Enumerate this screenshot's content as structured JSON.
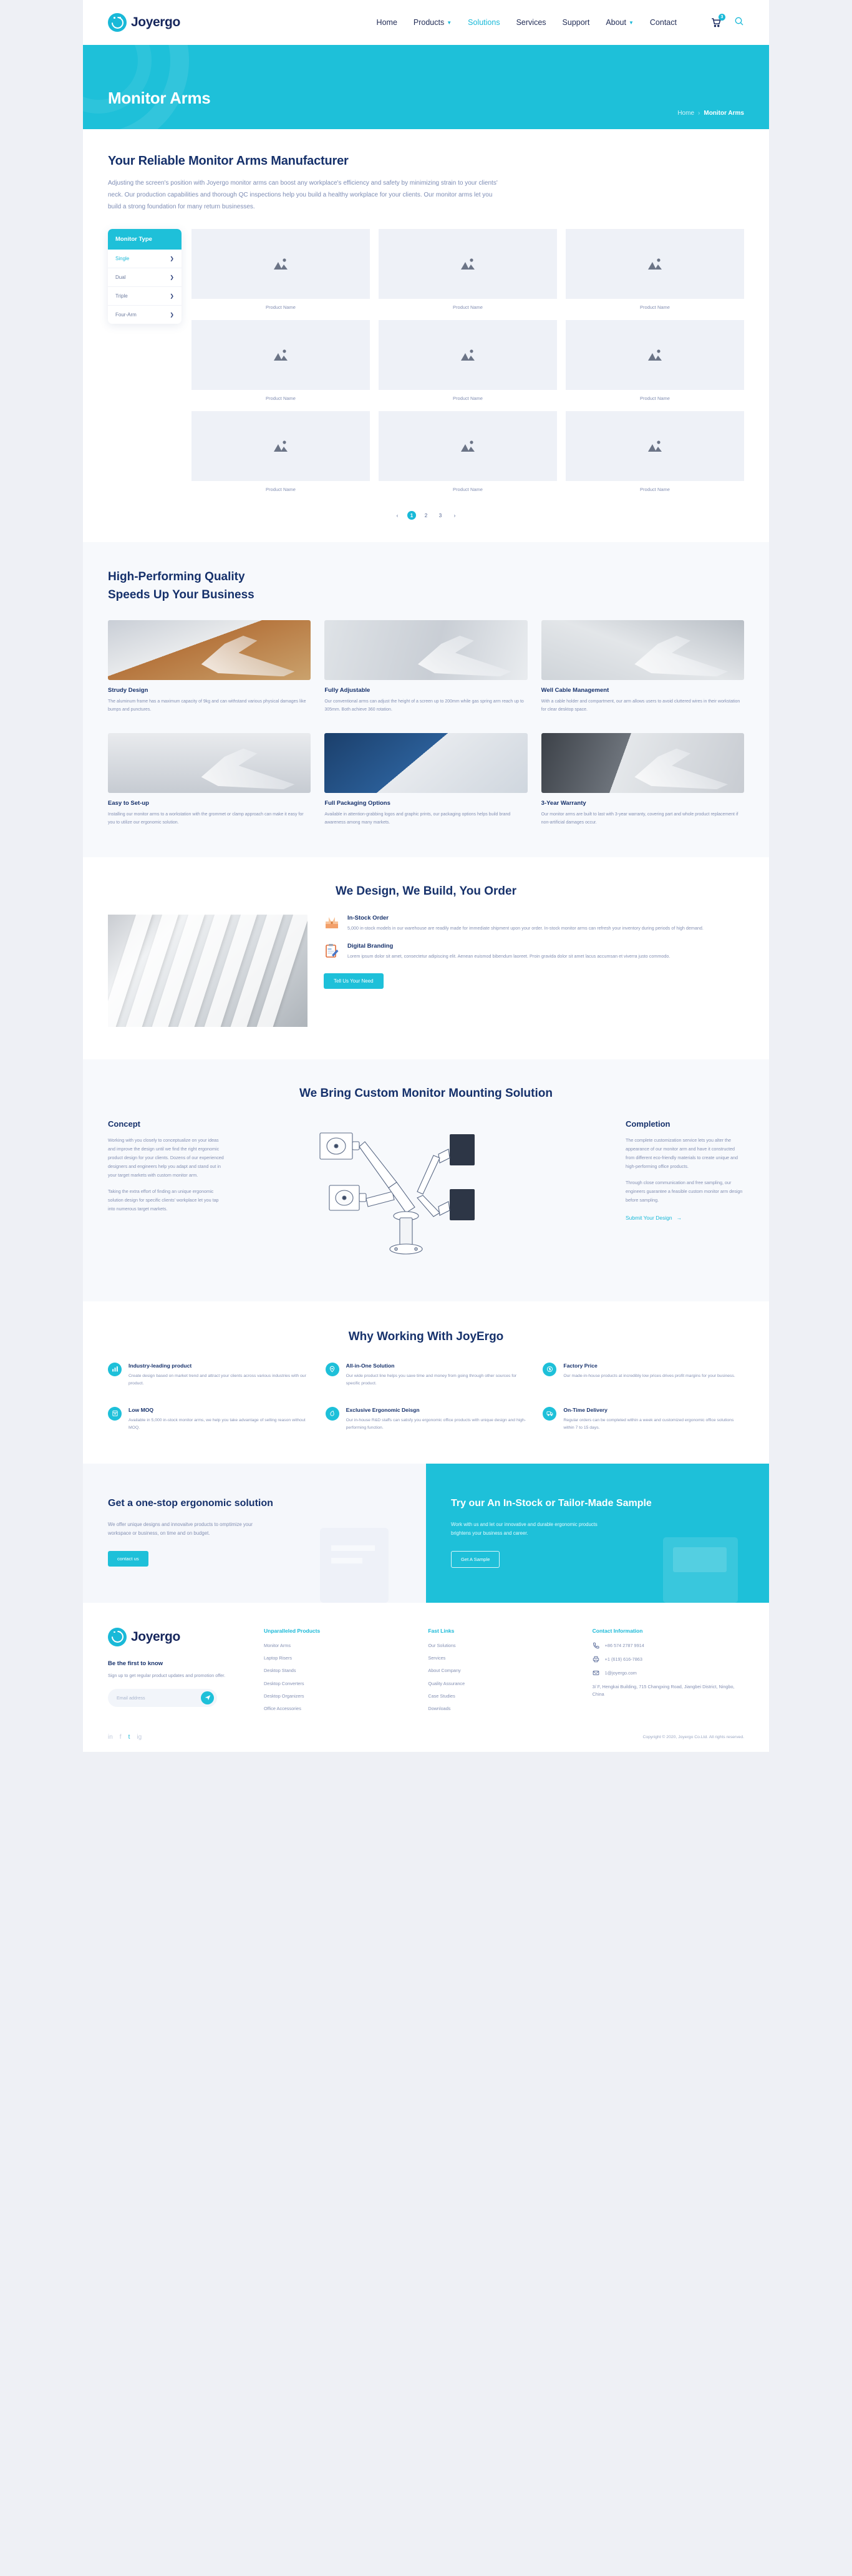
{
  "header": {
    "brand": "Joyergo",
    "nav": [
      {
        "label": "Home",
        "dropdown": false,
        "active": false
      },
      {
        "label": "Products",
        "dropdown": true,
        "active": false
      },
      {
        "label": "Solutions",
        "dropdown": false,
        "active": true
      },
      {
        "label": "Services",
        "dropdown": false,
        "active": false
      },
      {
        "label": "Support",
        "dropdown": false,
        "active": false
      },
      {
        "label": "About",
        "dropdown": true,
        "active": false
      },
      {
        "label": "Contact",
        "dropdown": false,
        "active": false
      }
    ],
    "cart_count": "3"
  },
  "hero": {
    "title": "Monitor Arms",
    "crumb_home": "Home",
    "crumb_sep": "›",
    "crumb_current": "Monitor Arms"
  },
  "intro": {
    "title": "Your Reliable Monitor Arms Manufacturer",
    "paragraph": "Adjusting the screen's position with Joyergo monitor arms can boost any workplace's efficiency and safety by minimizing strain to your clients' neck. Our production capabilities and thorough QC inspections help you build a healthy workplace for your clients. Our monitor arms let you build a strong foundation for many return businesses."
  },
  "filter": {
    "heading": "Monitor Type",
    "items": [
      {
        "label": "Single",
        "active": true
      },
      {
        "label": "Dual",
        "active": false
      },
      {
        "label": "Triple",
        "active": false
      },
      {
        "label": "Four-Arm",
        "active": false
      }
    ]
  },
  "products": {
    "cards": [
      {
        "name": "Product Name"
      },
      {
        "name": "Product Name"
      },
      {
        "name": "Product Name"
      },
      {
        "name": "Product Name"
      },
      {
        "name": "Product Name"
      },
      {
        "name": "Product Name"
      },
      {
        "name": "Product Name"
      },
      {
        "name": "Product Name"
      },
      {
        "name": "Product Name"
      }
    ],
    "pagination": {
      "prev": "‹",
      "next": "›",
      "pages": [
        "1",
        "2",
        "3"
      ],
      "current": "1"
    }
  },
  "quality": {
    "title_line1": "High-Performing Quality",
    "title_line2": "Speeds Up Your Business",
    "features": [
      {
        "title": "Strudy Design",
        "desc": "The aluminum frame has a maximum capacity of 9kg and can withstand various physical damages like bumps and punctures."
      },
      {
        "title": "Fully Adjustable",
        "desc": "Our conventional arms can adjust the height of a screen up to 200mm while gas spring arm reach up to 305mm. Both achieve 360 rotation."
      },
      {
        "title": "Well Cable Management",
        "desc": "With a cable holder and compartment, our arm allows users to avoid cluttered wires in their workstation for clear desktop space."
      },
      {
        "title": "Easy to Set-up",
        "desc": "Installing our monitor arms to a workstation with the grommet or clamp approach can make it easy for you to utilize our ergonomic solution."
      },
      {
        "title": "Full Packaging Options",
        "desc": "Available in attention-grabbing logos and graphic prints, our packaging options helps build brand awareness among many markets."
      },
      {
        "title": "3-Year Warranty",
        "desc": "Our monitor arms are built to last with 3-year warranty, covering part and whole product replacement if non-artificial damages occur."
      }
    ]
  },
  "dbo": {
    "title": "We Design, We Build, You Order",
    "rows": [
      {
        "title": "In-Stock Order",
        "desc": "5,000 in-stock models in our warehouse are readily made for immediate shipment upon your order. In-stock monitor arms can refresh your inventory during periods of high demand.",
        "icon": "box-icon"
      },
      {
        "title": "Digital Branding",
        "desc": "Lorem ipsum dolor sit amet, consectetur adipiscing elit. Aenean euismod bibendum laoreet. Proin gravida dolor sit amet lacus accumsan et viverra justo commodo.",
        "icon": "clipboard-icon"
      }
    ],
    "button": "Tell Us Your Need"
  },
  "custom": {
    "title": "We Bring Custom Monitor Mounting Solution",
    "left": {
      "heading": "Concept",
      "p1": "Working with you closely to conceptualize on your ideas and improve the design until we find the right ergonomic product design for your clients. Dozens of our experienced designers and engineers help you adapt and stand out in your target markets with custom monitor arm.",
      "p2": "Taking the extra effort of finding an unique ergonomic solution design for specific clients' workplace let you tap into numerous target markets."
    },
    "right": {
      "heading": "Completion",
      "p1": "The complete customization service lets you alter the appearance of our monitor arm and have it constructed from different eco-friendly materials to create unique and high-performing office products.",
      "p2": "Through close communication and free sampling, our engineers guarantee a feasible custom monitor arm design before sampling.",
      "link": "Submit Your Design",
      "link_arrow": "→"
    }
  },
  "why": {
    "title": "Why Working With JoyErgo",
    "items": [
      {
        "icon": "bar-chart-icon",
        "title": "Industry-leading product",
        "desc": "Create design based on market trend and attract your clients across various industries with our product."
      },
      {
        "icon": "location-heart-icon",
        "title": "All-in-One Solution",
        "desc": "Our wide product line helps you save time and money from going through other sources for specific product."
      },
      {
        "icon": "price-tag-icon",
        "title": "Factory Price",
        "desc": "Our made-in-house products at incredibly low prices drives profit margins for your business."
      },
      {
        "icon": "box-stack-icon",
        "title": "Low MOQ",
        "desc": "Available in 5,000 in-stock monitor arms, we help you take advantage of selling reason without MOQ."
      },
      {
        "icon": "design-pen-icon",
        "title": "Exclusive Ergonomic Deisgn",
        "desc": "Our in-house R&D staffs can satisfy you ergonomic office products with unique design and high-performing function."
      },
      {
        "icon": "delivery-truck-icon",
        "title": "On-Time Delivery",
        "desc": "Regular orders can be completed within a week and customized ergonomic office solutions within 7 to 15 days."
      }
    ]
  },
  "cta": {
    "left": {
      "title": "Get a one-stop ergonomic solution",
      "desc": "We offer unique designs and innovaitve products to omptimize your workspace or business, on time and on budget.",
      "button": "contact us"
    },
    "right": {
      "title": "Try our An In-Stock or Tailor-Made Sample",
      "desc": "Work with us and let our innovative and durable ergonomic products brightens your business and career.",
      "button": "Get A Sample"
    }
  },
  "footer": {
    "brand": "Joyergo",
    "newsletter_title": "Be the first to know",
    "newsletter_desc": "Sign up to get regular product updates and promotion offer.",
    "email_placeholder": "Email address",
    "email_value": "",
    "columns": [
      {
        "heading": "Unparalleled Products",
        "links": [
          "Monitor Arms",
          "Laptop Risers",
          "Desktop Stands",
          "Desktop Converters",
          "Desktop Organizers",
          "Office Accessories"
        ]
      },
      {
        "heading": "Fast Links",
        "links": [
          "Our Solutions",
          "Services",
          "About Company",
          "Quality Assurance",
          "Case Studies",
          "Downloads"
        ]
      }
    ],
    "contact": {
      "heading": "Contact Information",
      "phone": "+86 574 2787 9914",
      "fax": "+1  (619)  616-7863",
      "email": "1@joyergo.com",
      "address": "3/ F, Hengkai Building, 715 Changxing Road, Jiangbei District, Ningbo, China"
    },
    "socials": [
      "in",
      "f",
      "t",
      "ig"
    ],
    "copyright": "Copyright © 2020, Joyergo Co.Ltd. All rights reserved."
  }
}
